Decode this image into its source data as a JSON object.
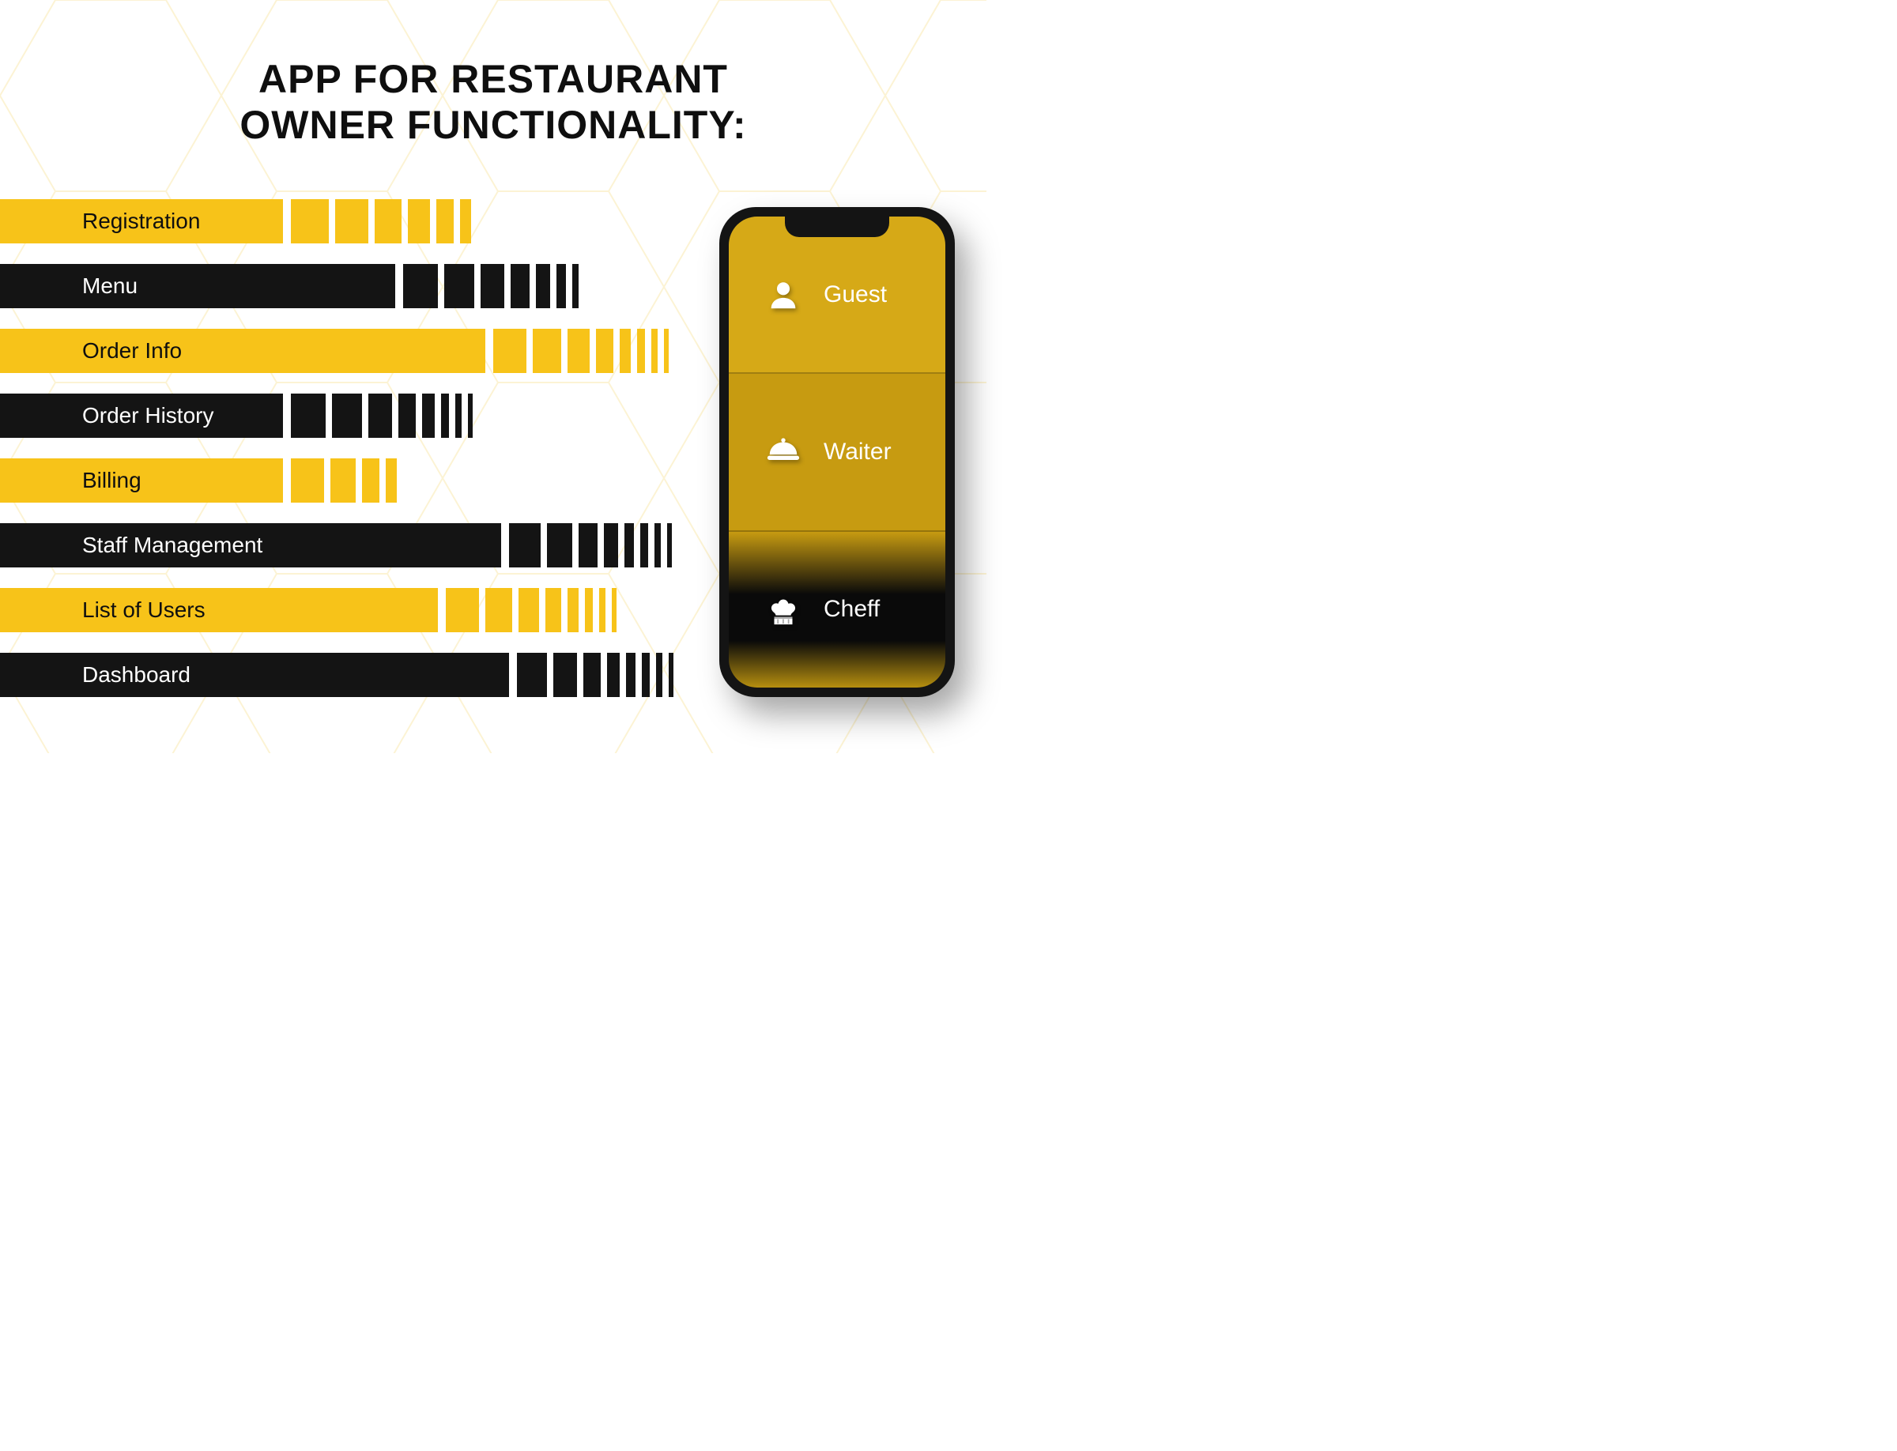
{
  "title_line1": "APP FOR RESTAURANT",
  "title_line2": "OWNER FUNCTIONALITY:",
  "colors": {
    "yellow": "#f7c319",
    "black": "#141414"
  },
  "bars": [
    {
      "label": "Registration",
      "color": "yellow",
      "main_width": 358,
      "dashes": [
        48,
        42,
        34,
        28,
        22,
        14
      ]
    },
    {
      "label": "Menu",
      "color": "black",
      "main_width": 500,
      "dashes": [
        44,
        38,
        30,
        24,
        18,
        12,
        8
      ]
    },
    {
      "label": "Order Info",
      "color": "yellow",
      "main_width": 614,
      "dashes": [
        42,
        36,
        28,
        22,
        14,
        10,
        8,
        6
      ]
    },
    {
      "label": "Order History",
      "color": "black",
      "main_width": 358,
      "dashes": [
        44,
        38,
        30,
        22,
        16,
        10,
        8,
        6
      ]
    },
    {
      "label": "Billing",
      "color": "yellow",
      "main_width": 358,
      "dashes": [
        42,
        32,
        22,
        14
      ]
    },
    {
      "label": "Staff Management",
      "color": "black",
      "main_width": 634,
      "dashes": [
        40,
        32,
        24,
        18,
        12,
        10,
        8,
        6
      ]
    },
    {
      "label": "List of Users",
      "color": "yellow",
      "main_width": 554,
      "dashes": [
        42,
        34,
        26,
        20,
        14,
        10,
        8,
        6
      ]
    },
    {
      "label": "Dashboard",
      "color": "black",
      "main_width": 664,
      "dashes": [
        38,
        30,
        22,
        16,
        12,
        10,
        8,
        6
      ]
    }
  ],
  "phone": {
    "roles": [
      {
        "label": "Guest",
        "icon": "user-icon",
        "style": "role-guest"
      },
      {
        "label": "Waiter",
        "icon": "cloche-icon",
        "style": "role-waiter"
      },
      {
        "label": "Cheff",
        "icon": "chef-hat-icon",
        "style": "role-cheff"
      }
    ]
  }
}
